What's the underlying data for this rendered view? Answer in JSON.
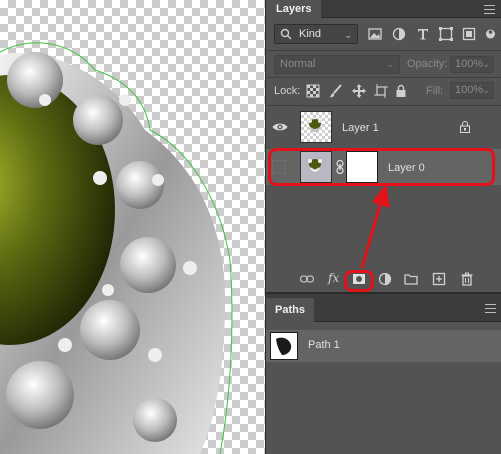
{
  "layers_panel": {
    "tab_label": "Layers",
    "filter": {
      "kind_label": "Kind",
      "icons": [
        "image-filter-icon",
        "adjustment-filter-icon",
        "type-filter-icon",
        "shape-filter-icon",
        "smart-object-filter-icon",
        "filter-toggle-icon"
      ]
    },
    "blend_mode": "Normal",
    "opacity_label": "Opacity:",
    "opacity_value": "100%",
    "lock_label": "Lock:",
    "fill_label": "Fill:",
    "fill_value": "100%",
    "layers": [
      {
        "name": "Layer 1",
        "visible": true,
        "locked": true,
        "selected": false
      },
      {
        "name": "Layer 0",
        "visible": false,
        "has_mask": true,
        "selected": true
      }
    ],
    "bottom_buttons": [
      "link-layers-icon",
      "fx-icon",
      "add-layer-mask-icon",
      "adjustment-layer-icon",
      "group-folder-icon",
      "new-layer-icon",
      "trash-icon"
    ],
    "fx_label": "fx"
  },
  "paths_panel": {
    "tab_label": "Paths",
    "paths": [
      {
        "name": "Path 1"
      }
    ]
  },
  "annotation": {
    "highlight_color": "#e3121a"
  }
}
